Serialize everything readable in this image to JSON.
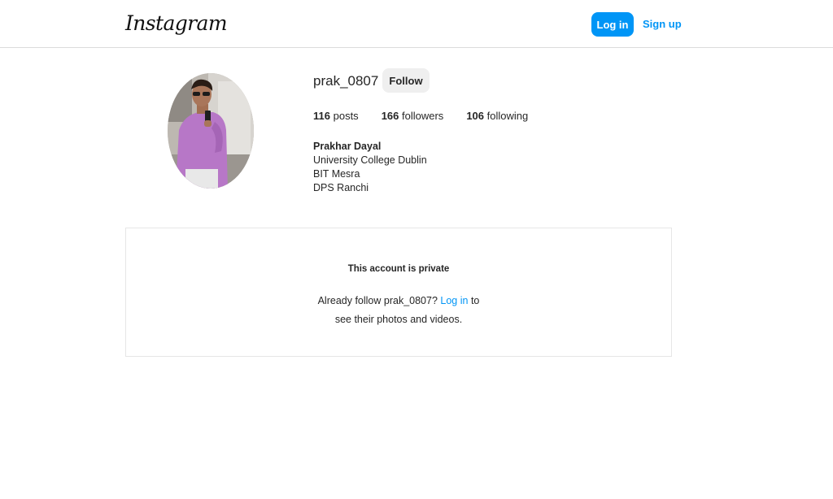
{
  "header": {
    "logo": "Instagram",
    "login_label": "Log in",
    "signup_label": "Sign up"
  },
  "profile": {
    "username": "prak_0807",
    "follow_label": "Follow",
    "stats": {
      "posts_count": "116",
      "posts_label": "posts",
      "followers_count": "166",
      "followers_label": "followers",
      "following_count": "106",
      "following_label": "following"
    },
    "bio": {
      "name": "Prakhar Dayal",
      "lines": [
        "University College Dublin",
        "BIT Mesra",
        "DPS Ranchi"
      ]
    }
  },
  "private": {
    "title": "This account is private",
    "text_before": "Already follow prak_0807?",
    "link_label": "Log in",
    "text_after": "to",
    "line2": "see their photos and videos."
  },
  "colors": {
    "accent": "#0095f6",
    "border": "#dbdbdb",
    "follow_bg": "#efefef"
  }
}
